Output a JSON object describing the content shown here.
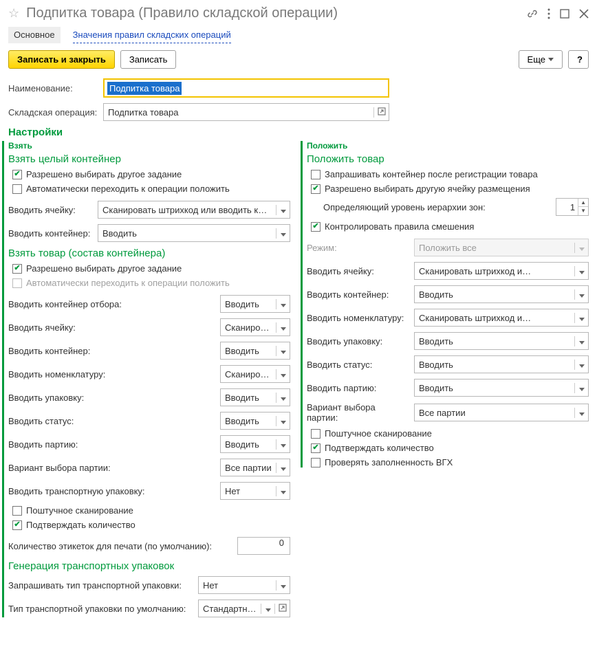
{
  "title": "Подпитка товара (Правило складской операции)",
  "tabs": {
    "main": "Основное",
    "values": "Значения правил складских операций"
  },
  "commands": {
    "save_close": "Записать и закрыть",
    "save": "Записать",
    "more": "Еще",
    "help": "?"
  },
  "fields": {
    "name_label": "Наименование:",
    "name_value": "Подпитка товара",
    "op_label": "Складская операция:",
    "op_value": "Подпитка товара"
  },
  "settings_header": "Настройки",
  "take": {
    "header": "Взять",
    "container_header": "Взять целый контейнер",
    "allow_other_task": "Разрешено выбирать другое задание",
    "auto_to_put": "Автоматически переходить к операции положить",
    "input_cell_label": "Вводить ячейку:",
    "input_cell_value": "Сканировать штрихкод или вводить контрольное число",
    "input_container_label": "Вводить контейнер:",
    "input_container_value": "Вводить",
    "goods_header": "Взять товар (состав контейнера)",
    "goods_allow_other": "Разрешено выбирать другое задание",
    "goods_auto_put": "Автоматически переходить к операции положить",
    "goods_pick_container_label": "Вводить контейнер отбора:",
    "goods_pick_container_value": "Вводить",
    "goods_cell_label": "Вводить ячейку:",
    "goods_cell_value": "Сканировать штрихкод и…",
    "goods_container_label": "Вводить контейнер:",
    "goods_container_value": "Вводить",
    "goods_nomen_label": "Вводить номенклатуру:",
    "goods_nomen_value": "Сканировать штрихкод и…",
    "goods_pack_label": "Вводить упаковку:",
    "goods_pack_value": "Вводить",
    "goods_status_label": "Вводить статус:",
    "goods_status_value": "Вводить",
    "goods_batch_label": "Вводить партию:",
    "goods_batch_value": "Вводить",
    "goods_batch_variant_label": "Вариант выбора партии:",
    "goods_batch_variant_value": "Все партии",
    "goods_trans_pack_label": "Вводить транспортную упаковку:",
    "goods_trans_pack_value": "Нет",
    "piece_scan": "Поштучное сканирование",
    "confirm_qty": "Подтверждать количество",
    "labels_qty_label": "Количество этикеток для печати (по умолчанию):",
    "labels_qty_value": "0",
    "gen_header": "Генерация транспортных упаковок",
    "ask_tp_type_label": "Запрашивать тип транспортной упаковки:",
    "ask_tp_type_value": "Нет",
    "default_tp_type_label": "Тип транспортной упаковки по умолчанию:",
    "default_tp_type_value": "Стандартная"
  },
  "put": {
    "header": "Положить",
    "goods_header": "Положить товар",
    "ask_container": "Запрашивать контейнер после регистрации товара",
    "allow_other_cell": "Разрешено выбирать другую ячейку размещения",
    "zone_level_label": "Определяющий уровень иерархии зон:",
    "zone_level_value": "1",
    "control_mix": "Контролировать правила смешения",
    "mode_label": "Режим:",
    "mode_value": "Положить все",
    "cell_label": "Вводить ячейку:",
    "cell_value": "Сканировать штрихкод и…",
    "container_label": "Вводить контейнер:",
    "container_value": "Вводить",
    "nomen_label": "Вводить номенклатуру:",
    "nomen_value": "Сканировать штрихкод и…",
    "pack_label": "Вводить упаковку:",
    "pack_value": "Вводить",
    "status_label": "Вводить статус:",
    "status_value": "Вводить",
    "batch_label": "Вводить партию:",
    "batch_value": "Вводить",
    "batch_variant_label": "Вариант выбора партии:",
    "batch_variant_value": "Все партии",
    "piece_scan": "Поштучное сканирование",
    "confirm_qty": "Подтверждать количество",
    "check_vgh": "Проверять заполненность ВГХ"
  }
}
